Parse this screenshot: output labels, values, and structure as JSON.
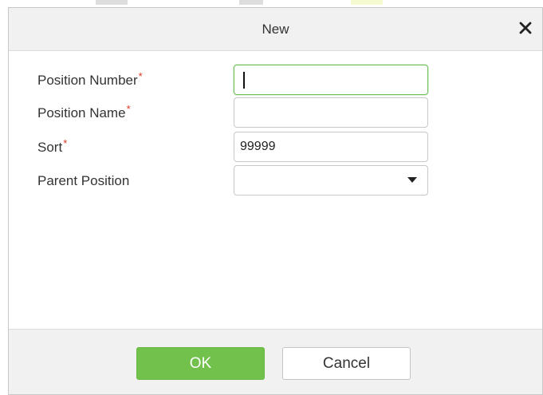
{
  "dialog": {
    "title": "New",
    "close_icon": "close-icon"
  },
  "form": {
    "position_number": {
      "label": "Position Number",
      "required_mark": "*",
      "value": "",
      "focused": true
    },
    "position_name": {
      "label": "Position Name",
      "required_mark": "*",
      "value": ""
    },
    "sort": {
      "label": "Sort",
      "required_mark": "*",
      "value": "99999"
    },
    "parent_position": {
      "label": "Parent Position",
      "selected": "",
      "dropdown_icon": "chevron-down-icon"
    }
  },
  "footer": {
    "ok_label": "OK",
    "cancel_label": "Cancel"
  },
  "colors": {
    "accent": "#72c14c",
    "required": "#e0341f",
    "focus_border": "#6fbf5a",
    "header_bg": "#f1f1f1"
  }
}
